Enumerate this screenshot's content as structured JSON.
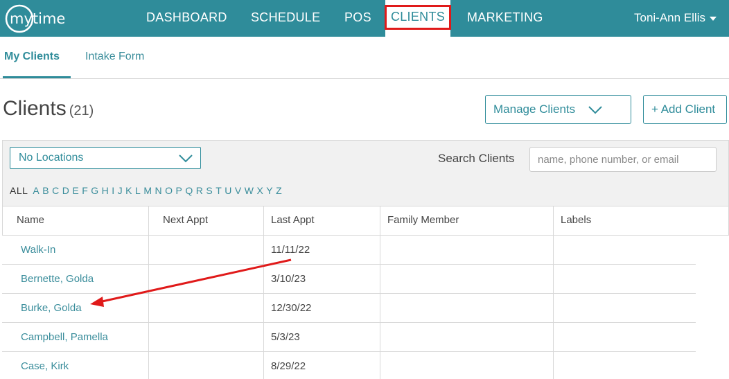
{
  "brand": {
    "logo_text": "mytime",
    "nav_color": "#2f8c9a",
    "accent_red": "#e01a1a"
  },
  "nav": {
    "items": [
      {
        "label": "DASHBOARD"
      },
      {
        "label": "SCHEDULE"
      },
      {
        "label": "POS"
      },
      {
        "label": "CLIENTS"
      },
      {
        "label": "MARKETING"
      }
    ],
    "active": "CLIENTS",
    "user": "Toni-Ann Ellis"
  },
  "subnav": {
    "tabs": [
      {
        "label": "My Clients"
      },
      {
        "label": "Intake Form"
      }
    ],
    "active": "My Clients"
  },
  "header": {
    "title": "Clients",
    "count": "(21)",
    "manage_label": "Manage Clients",
    "add_label": "+ Add Client"
  },
  "filters": {
    "location_value": "No Locations",
    "search_label": "Search Clients",
    "search_placeholder": "name, phone number, or email",
    "alpha": [
      "ALL",
      "A",
      "B",
      "C",
      "D",
      "E",
      "F",
      "G",
      "H",
      "I",
      "J",
      "K",
      "L",
      "M",
      "N",
      "O",
      "P",
      "Q",
      "R",
      "S",
      "T",
      "U",
      "V",
      "W",
      "X",
      "Y",
      "Z"
    ]
  },
  "table": {
    "columns": [
      "Name",
      "Next Appt",
      "Last Appt",
      "Family Member",
      "Labels"
    ],
    "rows": [
      {
        "name": "Walk-In",
        "next": "",
        "last": "11/11/22",
        "family": "",
        "labels": ""
      },
      {
        "name": "Bernette, Golda",
        "next": "",
        "last": "3/10/23",
        "family": "",
        "labels": ""
      },
      {
        "name": "Burke, Golda",
        "next": "",
        "last": "12/30/22",
        "family": "",
        "labels": ""
      },
      {
        "name": "Campbell, Pamella",
        "next": "",
        "last": "5/3/23",
        "family": "",
        "labels": ""
      },
      {
        "name": "Case, Kirk",
        "next": "",
        "last": "8/29/22",
        "family": "",
        "labels": ""
      }
    ]
  }
}
